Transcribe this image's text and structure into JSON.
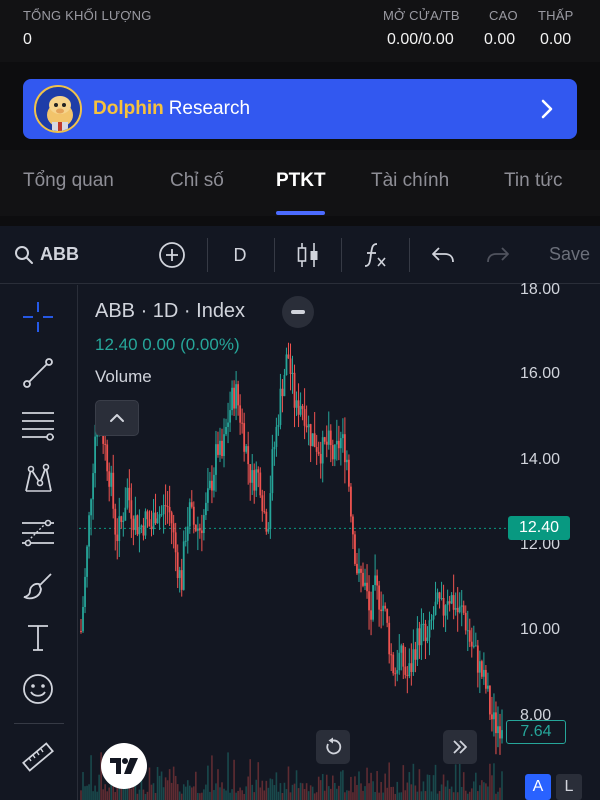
{
  "stats": {
    "volume_label": "TỔNG KHỐI LƯỢNG",
    "volume_value": "0",
    "open_label": "MỞ CỬA/TB",
    "open_value": "0.00/0.00",
    "high_label": "CAO",
    "high_value": "0.00",
    "low_label": "THẤP",
    "low_value": "0.00"
  },
  "banner": {
    "brand": "Dolphin",
    "suffix": "Research",
    "avatar_icon": "dolphin-mascot-icon",
    "chevron_icon": "chevron-right-icon"
  },
  "tabs": [
    {
      "label": "Tổng quan"
    },
    {
      "label": "Chỉ số"
    },
    {
      "label": "PTKT",
      "active": true
    },
    {
      "label": "Tài chính"
    },
    {
      "label": "Tin tức"
    }
  ],
  "toolbar": {
    "symbol": "ABB",
    "interval": "D",
    "save_label": "Save",
    "icons": [
      "search-icon",
      "add-circle-icon",
      "candles-icon",
      "function-icon",
      "undo-icon",
      "redo-icon"
    ]
  },
  "sidebar": {
    "tools": [
      "crosshair-icon",
      "trend-line-icon",
      "fib-lines-icon",
      "pattern-icon",
      "projection-icon",
      "brush-icon",
      "text-icon",
      "emoji-icon",
      "ruler-icon"
    ]
  },
  "legend": {
    "title": "ABB · 1D · Index",
    "ohlc": "12.40  0.00 (0.00%)",
    "volume": "Volume"
  },
  "colors": {
    "up": "#26a69a",
    "down": "#ef5350",
    "accent": "#2962ff",
    "banner": "#3258f0"
  },
  "chart_data": {
    "type": "candlestick",
    "symbol": "ABB",
    "interval": "1D",
    "price_ticks": [
      "18.00",
      "16.00",
      "14.00",
      "12.00",
      "10.00",
      "8.00"
    ],
    "ylim": [
      7.2,
      18.0
    ],
    "last_price": "12.40",
    "visible_low": "7.64",
    "close_path": [
      [
        0,
        10.0
      ],
      [
        5,
        11.5
      ],
      [
        10,
        13.3
      ],
      [
        14,
        14.6
      ],
      [
        18,
        15.1
      ],
      [
        24,
        14.3
      ],
      [
        30,
        13.4
      ],
      [
        35,
        12.2
      ],
      [
        40,
        12.5
      ],
      [
        46,
        13.3
      ],
      [
        52,
        12.7
      ],
      [
        58,
        12.4
      ],
      [
        64,
        12.6
      ],
      [
        70,
        12.4
      ],
      [
        75,
        12.9
      ],
      [
        80,
        12.7
      ],
      [
        85,
        13.0
      ],
      [
        90,
        12.6
      ],
      [
        95,
        11.7
      ],
      [
        100,
        11.1
      ],
      [
        104,
        12.3
      ],
      [
        108,
        12.8
      ],
      [
        112,
        12.5
      ],
      [
        118,
        12.4
      ],
      [
        124,
        12.8
      ],
      [
        130,
        13.5
      ],
      [
        136,
        14.3
      ],
      [
        140,
        14.0
      ],
      [
        145,
        14.8
      ],
      [
        150,
        15.4
      ],
      [
        154,
        15.6
      ],
      [
        158,
        15.1
      ],
      [
        162,
        14.6
      ],
      [
        166,
        14.0
      ],
      [
        170,
        13.5
      ],
      [
        174,
        13.7
      ],
      [
        178,
        13.6
      ],
      [
        182,
        12.8
      ],
      [
        186,
        12.5
      ],
      [
        190,
        13.9
      ],
      [
        194,
        14.6
      ],
      [
        198,
        15.4
      ],
      [
        202,
        16.0
      ],
      [
        206,
        16.5
      ],
      [
        210,
        15.8
      ],
      [
        214,
        15.1
      ],
      [
        218,
        15.4
      ],
      [
        222,
        15.2
      ],
      [
        228,
        14.6
      ],
      [
        234,
        14.4
      ],
      [
        240,
        14.2
      ],
      [
        246,
        14.4
      ],
      [
        252,
        14.0
      ],
      [
        258,
        14.5
      ],
      [
        264,
        14.2
      ],
      [
        268,
        13.1
      ],
      [
        272,
        12.0
      ],
      [
        276,
        11.2
      ],
      [
        280,
        11.3
      ],
      [
        284,
        10.9
      ],
      [
        288,
        10.2
      ],
      [
        292,
        11.0
      ],
      [
        296,
        10.8
      ],
      [
        300,
        10.7
      ],
      [
        304,
        10.2
      ],
      [
        308,
        9.5
      ],
      [
        312,
        9.0
      ],
      [
        316,
        9.4
      ],
      [
        320,
        9.3
      ],
      [
        324,
        8.9
      ],
      [
        328,
        9.1
      ],
      [
        332,
        9.6
      ],
      [
        336,
        9.9
      ],
      [
        340,
        10.0
      ],
      [
        344,
        9.6
      ],
      [
        348,
        10.1
      ],
      [
        352,
        10.5
      ],
      [
        356,
        10.6
      ],
      [
        360,
        10.4
      ],
      [
        364,
        10.9
      ],
      [
        368,
        10.8
      ],
      [
        372,
        10.6
      ],
      [
        376,
        10.4
      ],
      [
        380,
        10.5
      ],
      [
        384,
        10.1
      ],
      [
        388,
        9.7
      ],
      [
        392,
        9.5
      ],
      [
        396,
        9.2
      ],
      [
        400,
        8.9
      ],
      [
        404,
        8.6
      ],
      [
        408,
        8.0
      ],
      [
        412,
        7.8
      ],
      [
        416,
        7.8
      ],
      [
        419,
        7.9
      ]
    ],
    "volume_profile": [
      3,
      5,
      2,
      7,
      4,
      8,
      3,
      6,
      2,
      5,
      9,
      4,
      3,
      6,
      2,
      8,
      5,
      3,
      7,
      4,
      6,
      2,
      5,
      9,
      3,
      4,
      7,
      5,
      2,
      6,
      8,
      3,
      5,
      4,
      7,
      2,
      6,
      3,
      9,
      4,
      5,
      2,
      8,
      3,
      6,
      4,
      7,
      5,
      2,
      3
    ]
  },
  "controls": {
    "badge_a": "A",
    "badge_l": "L",
    "logo_icon": "tradingview-logo-icon"
  }
}
